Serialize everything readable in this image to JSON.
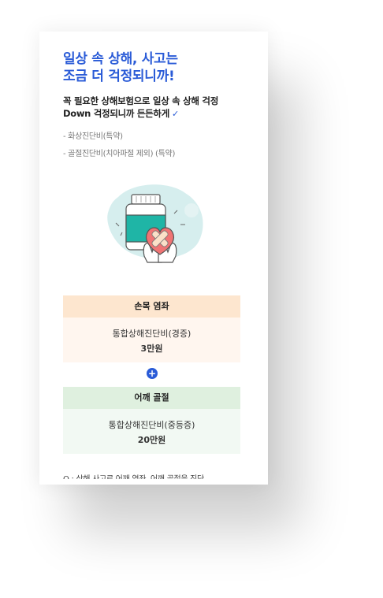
{
  "headline": {
    "line1": "일상 속 상해, 사고는",
    "line2": "조금 더 걱정되니까!"
  },
  "subhead": {
    "line1": "꼭 필요한 상해보험으로 일상 속 상해 걱정",
    "line2": "Down 걱정되니까 든든하게",
    "check_icon": "check-icon"
  },
  "bullets": [
    "- 화상진단비(특약)",
    "- 골절진단비(치아파절 제외) (특약)"
  ],
  "illustration": {
    "icon": "medicine-bottle-heart-hands"
  },
  "plan1": {
    "title": "손목 염좌",
    "label": "통합상해진단비(경증)",
    "amount": "3만원"
  },
  "plus_symbol": "+",
  "plan2": {
    "title": "어깨 골절",
    "label": "통합상해진단비(중등증)",
    "amount": "20만원"
  },
  "footer_cut": "Q : 상해 사고로 어깨 염좌, 어깨 골절을 진단",
  "colors": {
    "accent": "#2a5bd7",
    "orange_header": "#fde6cf",
    "orange_body": "#fff6ef",
    "green_header": "#dff0df",
    "green_body": "#f2f9f3"
  }
}
